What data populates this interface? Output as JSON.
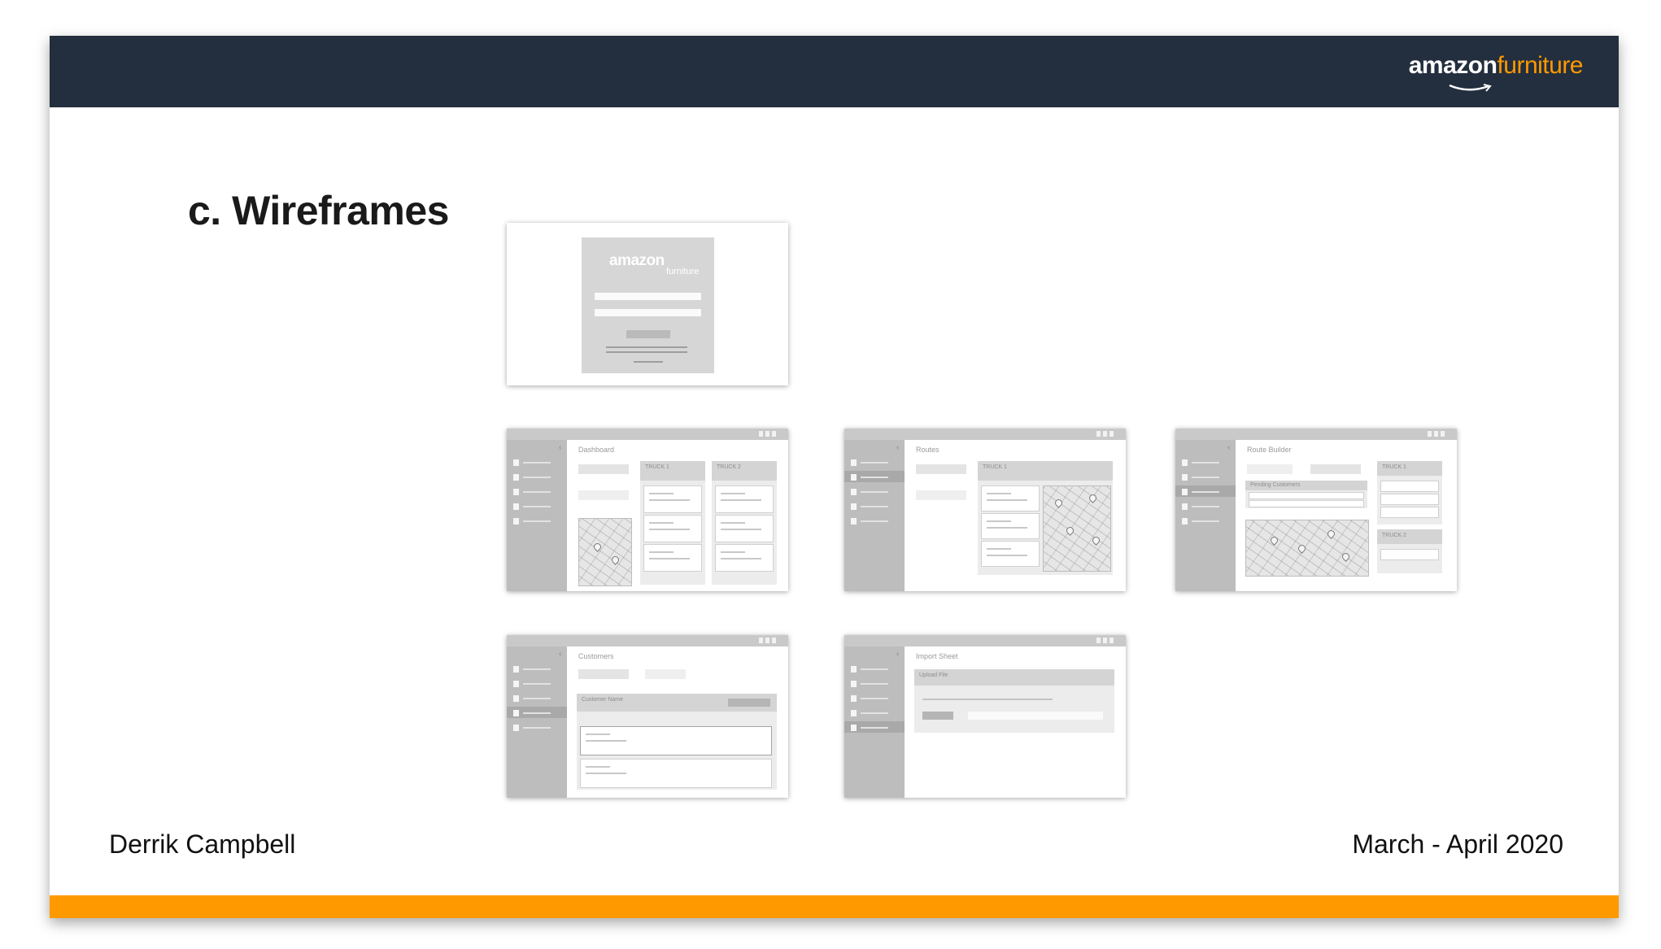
{
  "header": {
    "brand_primary": "amazon",
    "brand_secondary": "furniture",
    "brand_color": "#232f3e",
    "accent_color": "#ff9900"
  },
  "slide": {
    "title": "c. Wireframes",
    "author": "Derrik Campbell",
    "date": "March - April 2020"
  },
  "wireframes": {
    "login": {
      "logo_primary": "amazon",
      "logo_secondary": "furniture"
    },
    "dashboard": {
      "heading": "Dashboard",
      "columns": [
        "TRUCK 1",
        "TRUCK 2"
      ]
    },
    "routes": {
      "heading": "Routes",
      "columns": [
        "TRUCK 1"
      ]
    },
    "route_builder": {
      "heading": "Route Builder",
      "panel": "Pending Customers",
      "columns": [
        "TRUCK 1",
        "TRUCK 2"
      ]
    },
    "customers": {
      "heading": "Customers",
      "panel": "Customer Name"
    },
    "import": {
      "heading": "Import Sheet",
      "panel": "Upload File"
    }
  }
}
